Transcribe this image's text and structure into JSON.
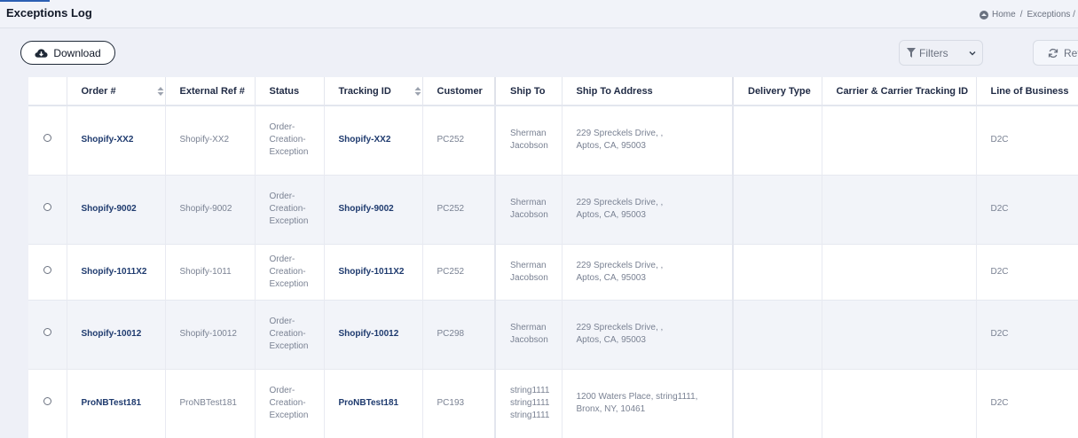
{
  "page": {
    "title": "Exceptions Log"
  },
  "breadcrumb": {
    "home": "Home",
    "separator": "/",
    "current": "Exceptions /"
  },
  "toolbar": {
    "download_label": "Download",
    "filters_label": "Filters",
    "refresh_label": "Refresh"
  },
  "icons": {
    "download": "cloud-download-icon",
    "filter": "filter-icon",
    "chevron": "chevron-down-icon",
    "refresh": "refresh-icon",
    "sort": "sort-icon",
    "home": "home-icon"
  },
  "table": {
    "columns": {
      "order": "Order #",
      "external_ref": "External Ref #",
      "status": "Status",
      "tracking": "Tracking ID",
      "customer": "Customer",
      "ship_to": "Ship To",
      "ship_to_address": "Ship To Address",
      "delivery_type": "Delivery Type",
      "carrier": "Carrier & Carrier Tracking ID",
      "lob": "Line of Business"
    },
    "rows": [
      {
        "order": "Shopify-XX2",
        "external_ref": "Shopify-XX2",
        "status_1": "Order-",
        "status_2": "Creation-",
        "status_3": "Exception",
        "tracking": "Shopify-XX2",
        "customer": "PC252",
        "ship_to_1": "Sherman",
        "ship_to_2": "Jacobson",
        "ship_to_3": "",
        "address_1": "229 Spreckels Drive, ,",
        "address_2": "Aptos, CA, 95003",
        "delivery_type": "",
        "carrier": "",
        "lob": "D2C"
      },
      {
        "order": "Shopify-9002",
        "external_ref": "Shopify-9002",
        "status_1": "Order-",
        "status_2": "Creation-",
        "status_3": "Exception",
        "tracking": "Shopify-9002",
        "customer": "PC252",
        "ship_to_1": "Sherman",
        "ship_to_2": "Jacobson",
        "ship_to_3": "",
        "address_1": "229 Spreckels Drive, ,",
        "address_2": "Aptos, CA, 95003",
        "delivery_type": "",
        "carrier": "",
        "lob": "D2C"
      },
      {
        "order": "Shopify-1011X2",
        "external_ref": "Shopify-1011",
        "status_1": "Order-",
        "status_2": "Creation-",
        "status_3": "Exception",
        "tracking": "Shopify-1011X2",
        "customer": "PC252",
        "ship_to_1": "Sherman",
        "ship_to_2": "Jacobson",
        "ship_to_3": "",
        "address_1": "229 Spreckels Drive, ,",
        "address_2": "Aptos, CA, 95003",
        "delivery_type": "",
        "carrier": "",
        "lob": "D2C"
      },
      {
        "order": "Shopify-10012",
        "external_ref": "Shopify-10012",
        "status_1": "Order-",
        "status_2": "Creation-",
        "status_3": "Exception",
        "tracking": "Shopify-10012",
        "customer": "PC298",
        "ship_to_1": "Sherman",
        "ship_to_2": "Jacobson",
        "ship_to_3": "",
        "address_1": "229 Spreckels Drive, ,",
        "address_2": "Aptos, CA, 95003",
        "delivery_type": "",
        "carrier": "",
        "lob": "D2C"
      },
      {
        "order": "ProNBTest181",
        "external_ref": "ProNBTest181",
        "status_1": "Order-",
        "status_2": "Creation-",
        "status_3": "Exception",
        "tracking": "ProNBTest181",
        "customer": "PC193",
        "ship_to_1": "string1111",
        "ship_to_2": "string1111",
        "ship_to_3": "string1111",
        "address_1": "1200 Waters Place, string1111,",
        "address_2": "Bronx, NY, 10461",
        "delivery_type": "",
        "carrier": "",
        "lob": "D2C"
      }
    ]
  }
}
